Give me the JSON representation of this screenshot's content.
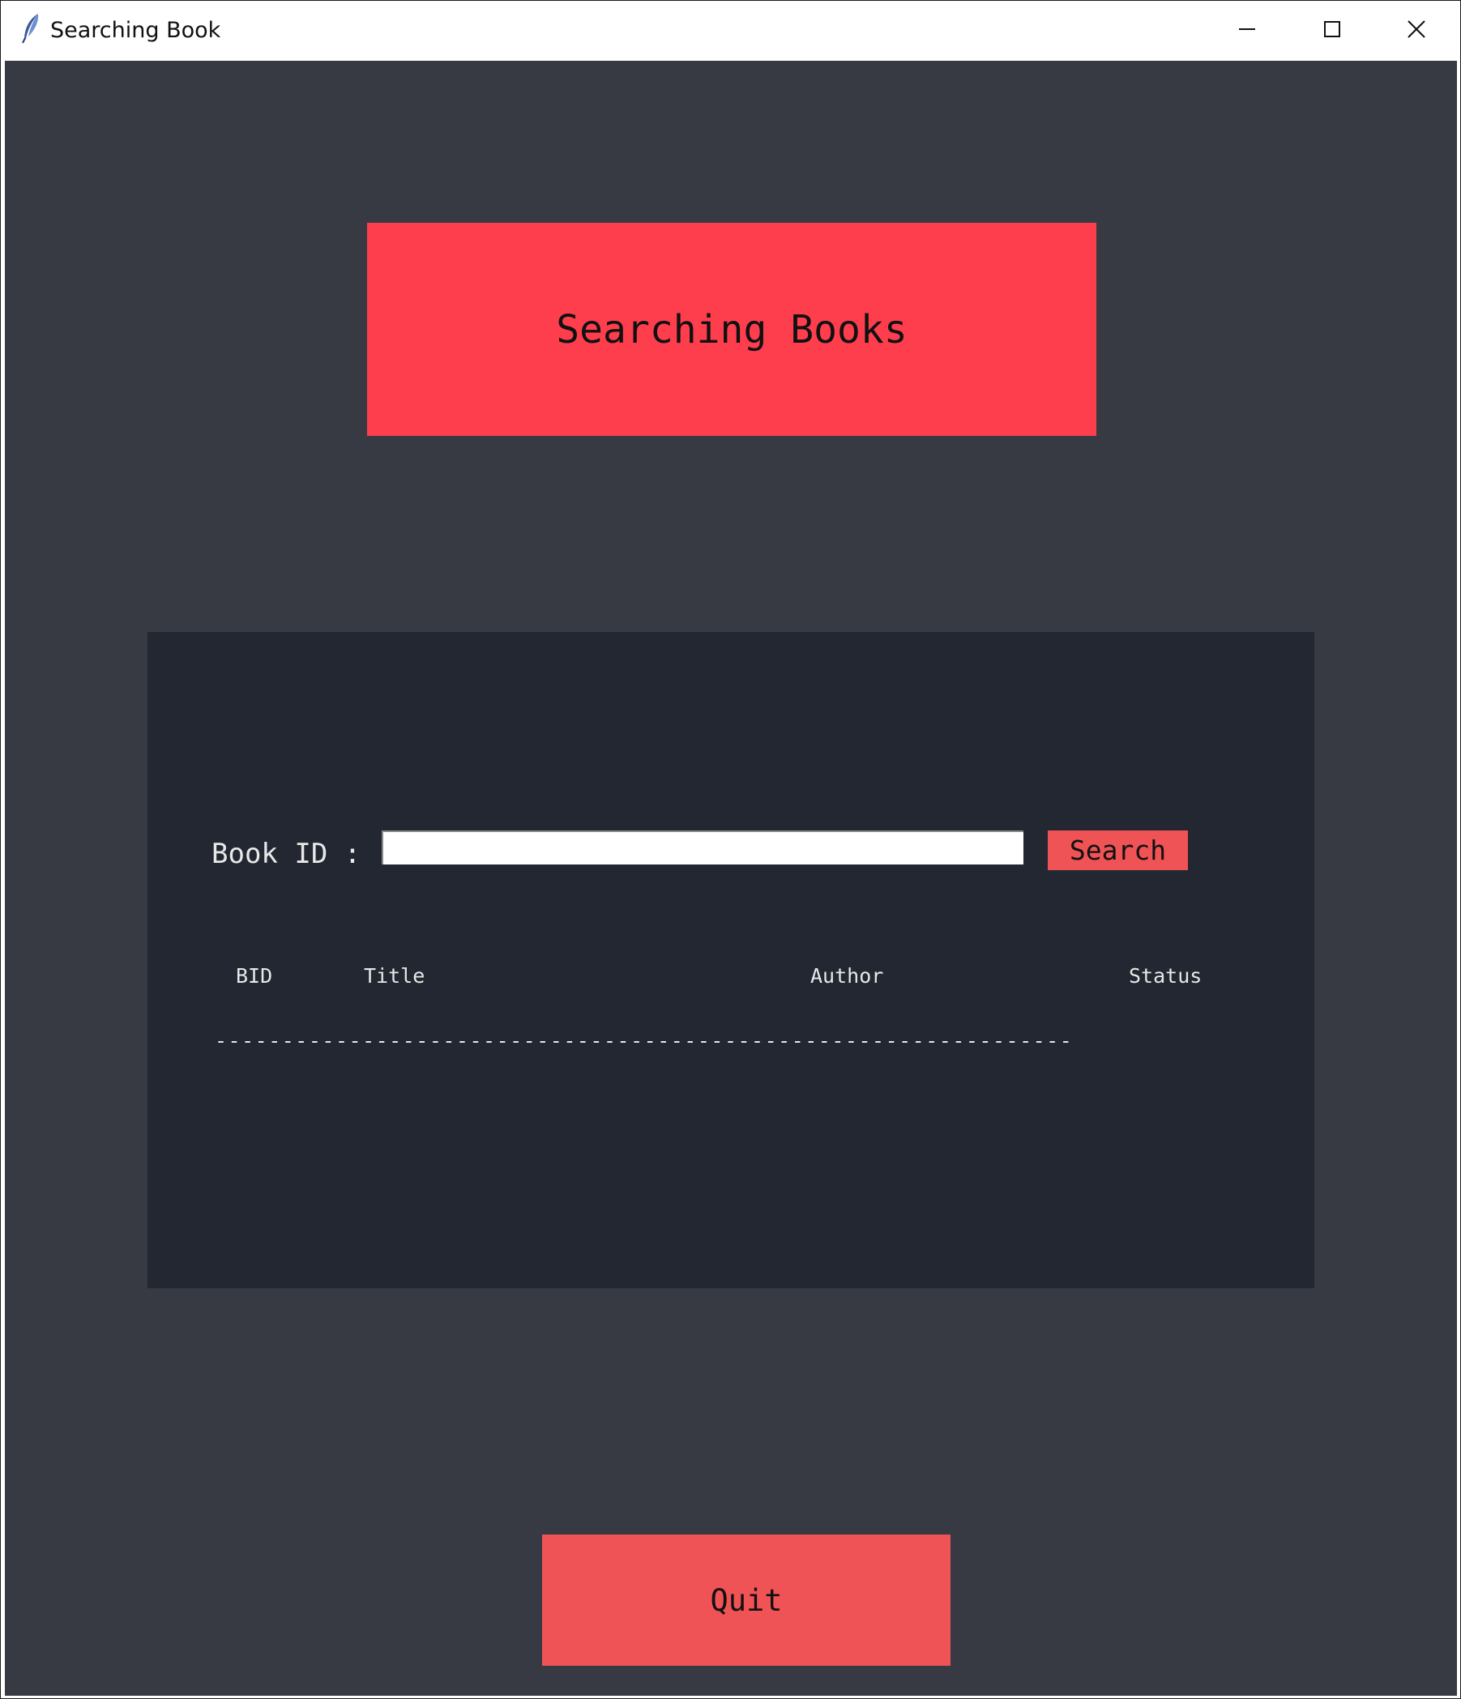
{
  "window": {
    "title": "Searching Book",
    "app_icon": "feather-icon",
    "controls": [
      "minimize-icon",
      "maximize-icon",
      "close-icon"
    ]
  },
  "heading": {
    "text": "Searching Books"
  },
  "search": {
    "label": "Book ID :",
    "input_value": "",
    "button_label": "Search"
  },
  "table": {
    "columns": [
      "BID",
      "Title",
      "Author",
      "Status"
    ],
    "separator": "----------------------------------------------------------------"
  },
  "footer": {
    "quit_label": "Quit"
  },
  "colors": {
    "background": "#383a43",
    "panel": "#222731",
    "heading_accent": "#ff3e4d",
    "button_accent": "#f05355"
  }
}
